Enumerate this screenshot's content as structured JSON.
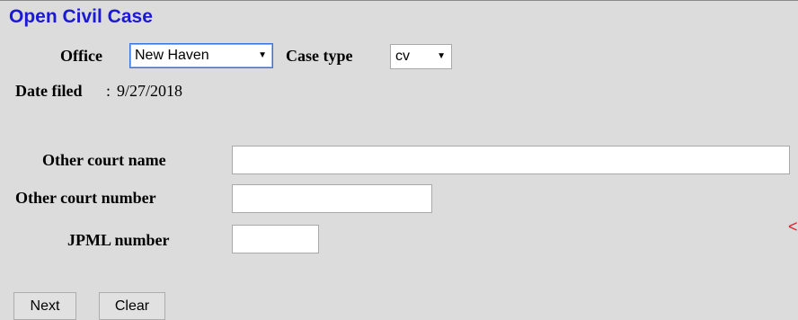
{
  "page": {
    "title": "Open Civil Case"
  },
  "office": {
    "label": "Office",
    "selected": "New Haven",
    "arrow": "▼"
  },
  "case_type": {
    "label": "Case type",
    "selected": "cv",
    "arrow": "▼"
  },
  "date_filed": {
    "label": "Date filed",
    "separator": ":",
    "value": "9/27/2018"
  },
  "fields": {
    "other_court_name": {
      "label": "Other court name",
      "value": ""
    },
    "other_court_number": {
      "label": "Other court number",
      "value": ""
    },
    "jpml_number": {
      "label": "JPML number",
      "value": ""
    }
  },
  "buttons": {
    "next": "Next",
    "clear": "Clear"
  },
  "edge_mark": "<",
  "colors": {
    "background": "#dcdcdc",
    "title": "#1a1ad4",
    "focus_border": "#3a73d8",
    "edge_mark": "#e0202a"
  }
}
